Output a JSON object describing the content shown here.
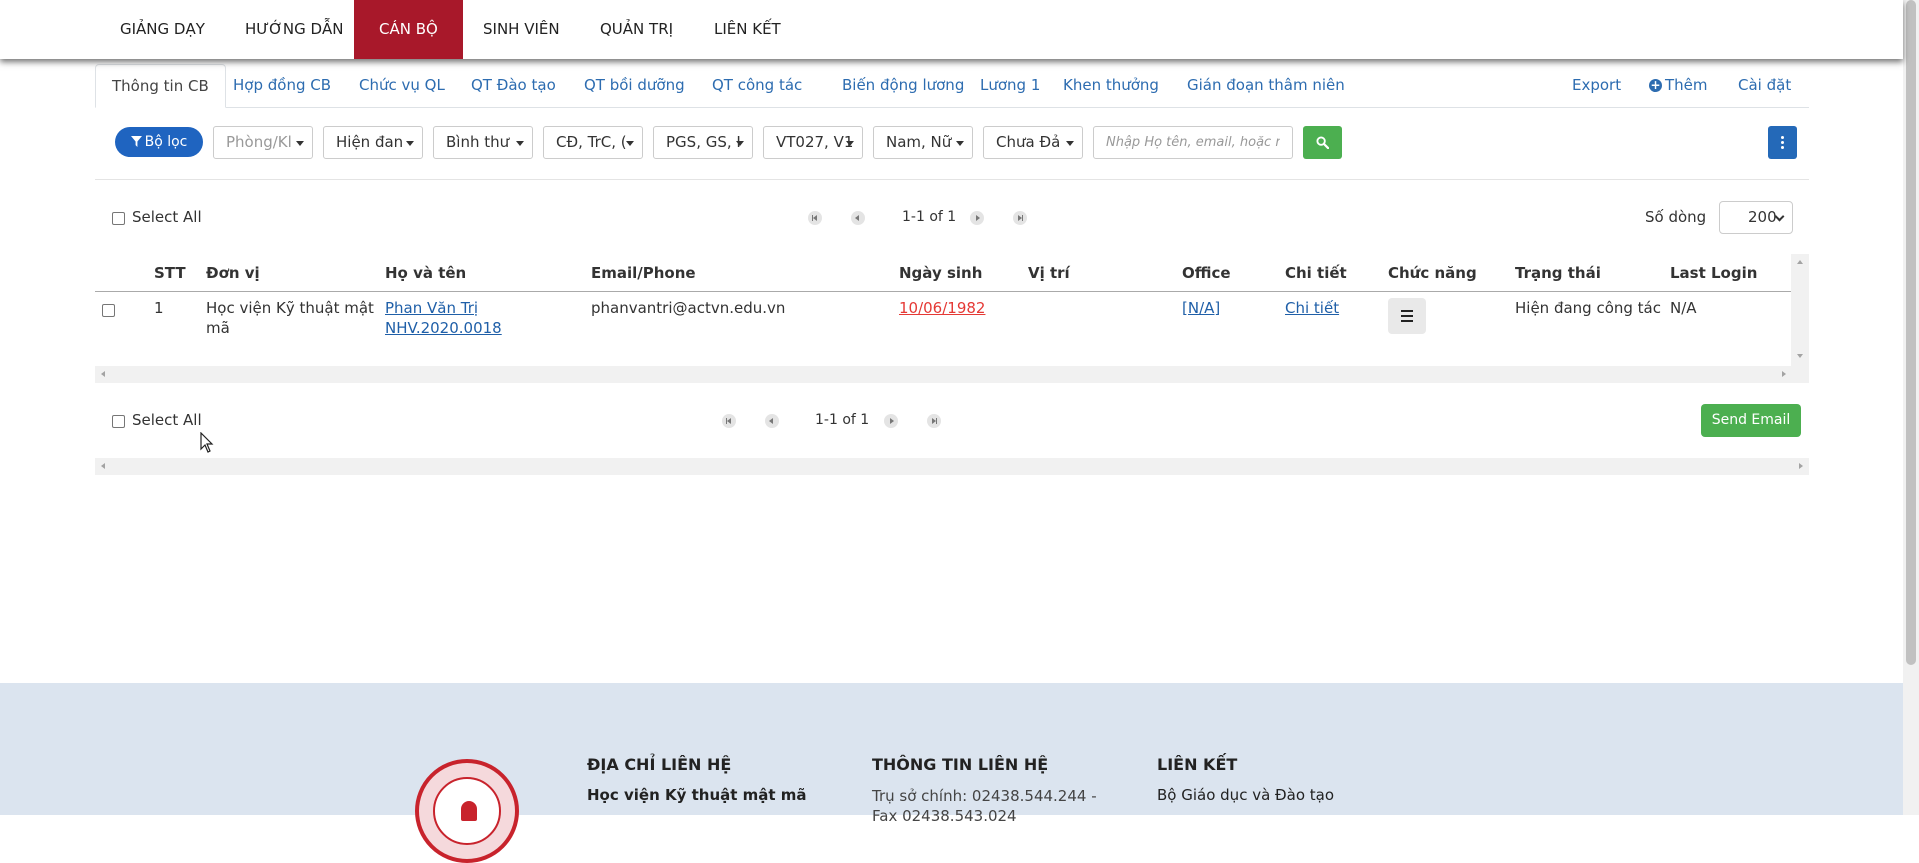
{
  "nav": {
    "items": [
      {
        "label": "GIẢNG DẠY",
        "active": false
      },
      {
        "label": "HƯỚNG DẪN",
        "active": false
      },
      {
        "label": "CÁN BỘ",
        "active": true
      },
      {
        "label": "SINH VIÊN",
        "active": false
      },
      {
        "label": "QUẢN TRỊ",
        "active": false
      },
      {
        "label": "LIÊN KẾT",
        "active": false
      }
    ],
    "active_color": "#a8182a"
  },
  "tabs": {
    "items": [
      {
        "label": "Thông tin CB",
        "active": true
      },
      {
        "label": "Hợp đồng CB"
      },
      {
        "label": "Chức vụ QL"
      },
      {
        "label": "QT Đào tạo"
      },
      {
        "label": "QT bồi dưỡng"
      },
      {
        "label": "QT công tác"
      },
      {
        "label": "Biến động lương"
      },
      {
        "label": "Lương 1"
      },
      {
        "label": "Khen thưởng"
      },
      {
        "label": "Gián đoạn thâm niên"
      }
    ],
    "right": {
      "export": "Export",
      "add": "Thêm",
      "settings": "Cài đặt"
    }
  },
  "filters": {
    "filter_button": "Bộ lọc",
    "dropdowns": [
      "Phòng/Kl",
      "Hiện đan",
      "Bình thư",
      "CĐ, TrC, (",
      "PGS, GS, I",
      "VT027, V1",
      "Nam, Nữ",
      "Chưa Đả"
    ],
    "search_placeholder": "Nhập Họ tên, email, hoặc m"
  },
  "pager": {
    "select_all": "Select All",
    "range": "1-1 of 1",
    "rows_label": "Số dòng",
    "rows_value": "200"
  },
  "table": {
    "headers": [
      "STT",
      "Đơn vị",
      "Họ và tên",
      "Email/Phone",
      "Ngày sinh",
      "Vị trí",
      "Office",
      "Chi tiết",
      "Chức năng",
      "Trạng thái",
      "Last Login"
    ],
    "rows": [
      {
        "stt": "1",
        "don_vi_line1": "Học viện Kỹ thuật mật",
        "don_vi_line2": "mã",
        "ho_ten": "Phan Văn Trị",
        "ma": "NHV.2020.0018",
        "email": "phanvantri@actvn.edu.vn",
        "ngay_sinh": "10/06/1982",
        "vi_tri": "",
        "office": "[N/A]",
        "chi_tiet": "Chi tiết",
        "trang_thai": "Hiện đang công tác",
        "last_login": "N/A"
      }
    ]
  },
  "bottom": {
    "send_email": "Send Email"
  },
  "footer": {
    "contact_address_title": "ĐỊA CHỈ LIÊN HỆ",
    "contact_address_sub": "Học viện Kỹ thuật mật mã",
    "contact_info_title": "THÔNG TIN LIÊN HỆ",
    "contact_info_sub": "Trụ sở chính: 02438.544.244 - Fax 02438.543.024",
    "links_title": "LIÊN KẾT",
    "links_sub": "Bộ Giáo dục và Đào tạo"
  },
  "colors": {
    "primary": "#1f64c0",
    "success": "#4caf50",
    "link": "#2d6cb0",
    "date": "#e53935",
    "footer_bg": "#dbe4ef"
  }
}
